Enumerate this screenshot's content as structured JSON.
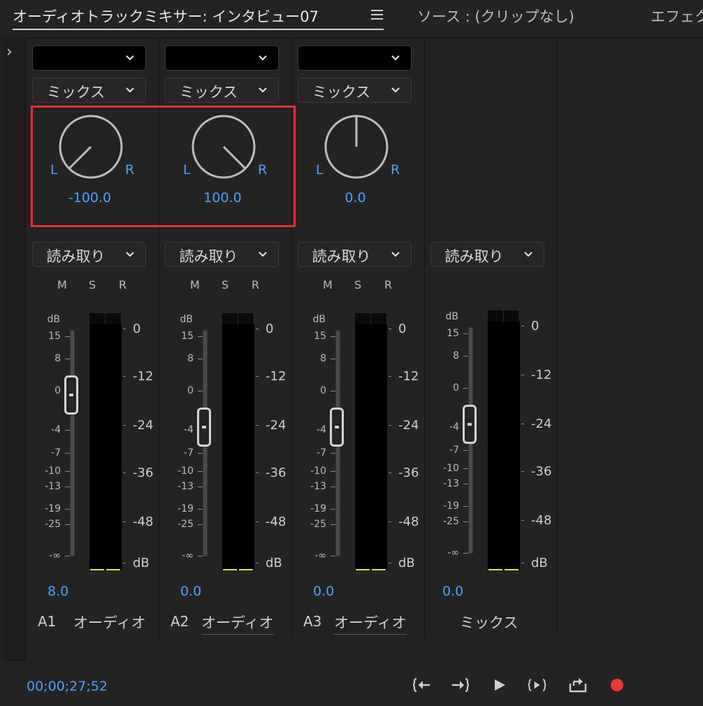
{
  "tabs": {
    "mixer": "オーディオトラックミキサー: インタビュー07",
    "source": "ソース : (クリップなし)",
    "effects": "エフェク"
  },
  "colors": {
    "accent": "#4aa2ff",
    "highlight_box": "#e0313b",
    "record": "#ec3a31",
    "meter_peak": "#e7e52a"
  },
  "msr": {
    "m": "M",
    "s": "S",
    "r": "R"
  },
  "pan": {
    "left": "L",
    "right": "R"
  },
  "fader_scale": {
    "unit": "dB",
    "labels": [
      "15",
      "8",
      "0",
      "-4",
      "-7",
      "-10",
      "-13",
      "-19",
      "-25",
      "-∞"
    ]
  },
  "meter_scale": {
    "labels": [
      "0",
      "-12",
      "-24",
      "-36",
      "-48",
      "dB"
    ]
  },
  "tracks": [
    {
      "id": "A1",
      "name": "オーディオ",
      "input": "",
      "send": "ミックス",
      "pan_value": "-100.0",
      "pan": -100,
      "automation": "読み取り",
      "volume_label": "8.0",
      "volume_db": 8
    },
    {
      "id": "A2",
      "name": "オーディオ",
      "input": "",
      "send": "ミックス",
      "pan_value": "100.0",
      "pan": 100,
      "automation": "読み取り",
      "volume_label": "0.0",
      "volume_db": 0
    },
    {
      "id": "A3",
      "name": "オーディオ",
      "input": "",
      "send": "ミックス",
      "pan_value": "0.0",
      "pan": 0,
      "automation": "読み取り",
      "volume_label": "0.0",
      "volume_db": 0
    }
  ],
  "master": {
    "name": "ミックス",
    "automation": "読み取り",
    "volume_label": "0.0",
    "volume_db": 0
  },
  "transport": {
    "timecode": "00;00;27;52",
    "buttons": [
      "go-to-in-icon",
      "go-to-out-icon",
      "play-icon",
      "play-in-to-out-icon",
      "loop-icon",
      "record-icon"
    ]
  }
}
